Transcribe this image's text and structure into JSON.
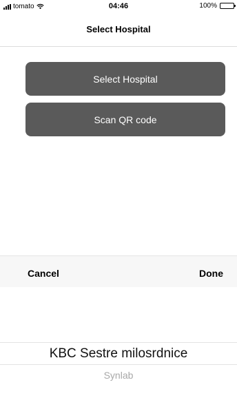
{
  "status_bar": {
    "carrier": "tomato",
    "time": "04:46",
    "battery": "100%"
  },
  "nav": {
    "title": "Select Hospital"
  },
  "buttons": {
    "select_hospital": "Select Hospital",
    "scan_qr": "Scan QR code"
  },
  "picker": {
    "cancel_label": "Cancel",
    "done_label": "Done",
    "selected": "KBC Sestre milosrdnice",
    "next": "Synlab"
  },
  "colors": {
    "button_bg": "#5a5a5a",
    "toolbar_bg": "#f7f7f7"
  }
}
